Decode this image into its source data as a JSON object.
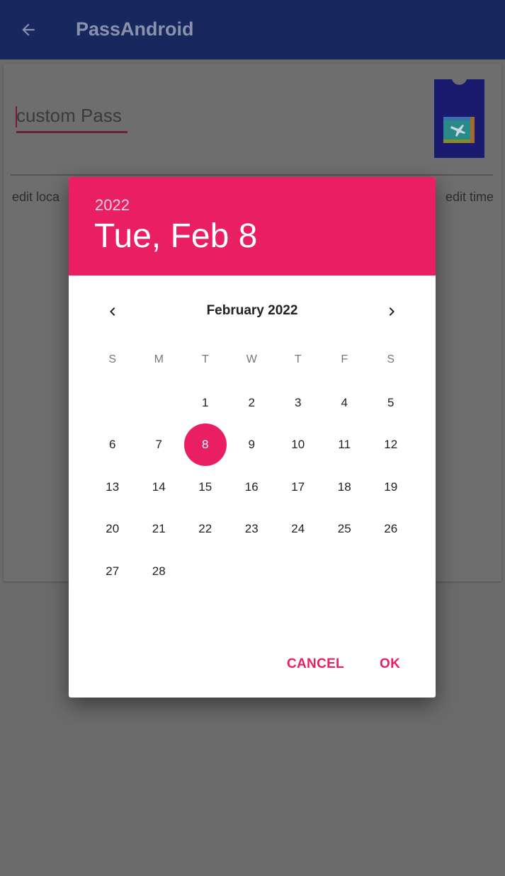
{
  "app_bar": {
    "title": "PassAndroid",
    "back_icon": "arrow-left-icon"
  },
  "pass": {
    "name_value": "custom Pass",
    "edit_location": "edit loca",
    "edit_time": "edit time",
    "icon": "airplane-ticket-icon"
  },
  "dialog": {
    "header_year": "2022",
    "header_date": "Tue, Feb 8",
    "month_label": "February 2022",
    "prev_icon": "chevron-left-icon",
    "next_icon": "chevron-right-icon",
    "weekdays": [
      "S",
      "M",
      "T",
      "W",
      "T",
      "F",
      "S"
    ],
    "weeks": [
      [
        "",
        "",
        "1",
        "2",
        "3",
        "4",
        "5"
      ],
      [
        "6",
        "7",
        "8",
        "9",
        "10",
        "11",
        "12"
      ],
      [
        "13",
        "14",
        "15",
        "16",
        "17",
        "18",
        "19"
      ],
      [
        "20",
        "21",
        "22",
        "23",
        "24",
        "25",
        "26"
      ],
      [
        "27",
        "28",
        "",
        "",
        "",
        "",
        ""
      ]
    ],
    "selected_day": "8",
    "cancel_label": "CANCEL",
    "ok_label": "OK",
    "accent_color": "#ea1e63"
  }
}
